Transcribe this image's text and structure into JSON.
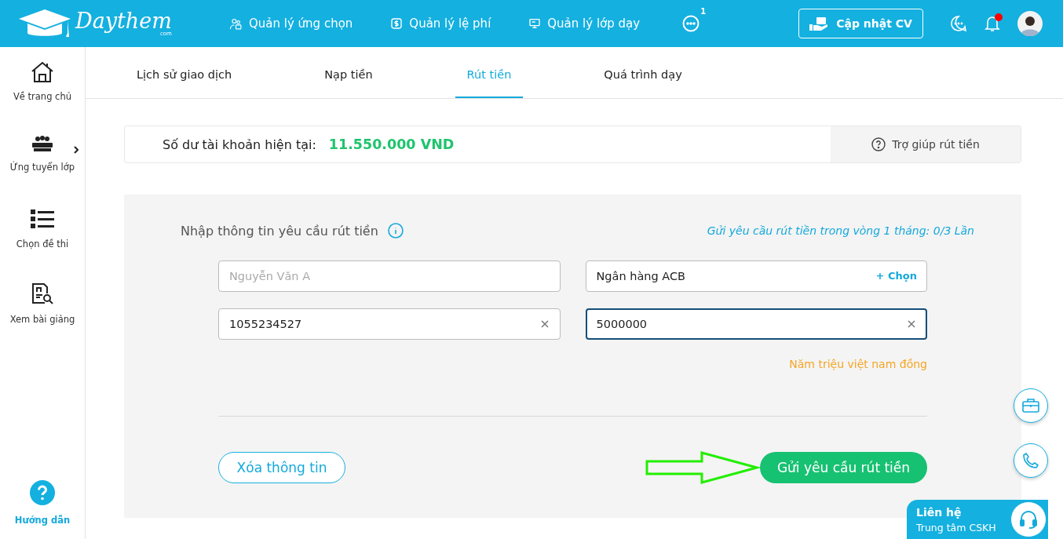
{
  "header": {
    "logo": "Daythem",
    "logo_suffix": "com",
    "nav": [
      {
        "label": "Quản lý ứng chọn"
      },
      {
        "label": "Quản lý lệ phí"
      },
      {
        "label": "Quản lý lớp dạy"
      }
    ],
    "more_badge": "1",
    "cv_button": "Cập nhật CV",
    "notification_dot": true
  },
  "sidebar": {
    "items": [
      {
        "label": "Về trang chủ",
        "has_submenu": false
      },
      {
        "label": "Ứng tuyển lớp",
        "has_submenu": true
      },
      {
        "label": "Chọn đề thi",
        "has_submenu": false
      },
      {
        "label": "Xem bài giảng",
        "has_submenu": false
      }
    ],
    "help": "Hướng dẫn"
  },
  "tabs": [
    {
      "label": "Lịch sử giao dịch",
      "selected": false
    },
    {
      "label": "Nạp tiền",
      "selected": false
    },
    {
      "label": "Rút tiền",
      "selected": true
    },
    {
      "label": "Quá trình dạy",
      "selected": false
    }
  ],
  "balance": {
    "label": "Số dư tài khoản hiện tại:",
    "amount": "11.550.000 VND",
    "help_button": "Trợ giúp rút tiền"
  },
  "form": {
    "title": "Nhập thông tin yêu cầu rút tiền",
    "limit_note": "Gửi yêu cầu rút tiền trong vòng 1 tháng: 0/3 Lần",
    "fields": [
      {
        "kind": "text",
        "placeholder": "Nguyễn Văn A",
        "focused": false
      },
      {
        "kind": "select",
        "value": "Ngân hàng ACB",
        "action": "+ Chọn",
        "focused": false
      },
      {
        "kind": "clearable",
        "value": "1055234527",
        "focused": false
      },
      {
        "kind": "clearable",
        "value": "5000000",
        "focused": true
      }
    ],
    "amount_in_words": "Năm triệu việt nam đồng",
    "clear_button": "Xóa thông tin",
    "submit_button": "Gửi yêu cầu rút tiền"
  },
  "contact": {
    "title": "Liên hệ",
    "subtitle": "Trung tâm CSKH"
  }
}
